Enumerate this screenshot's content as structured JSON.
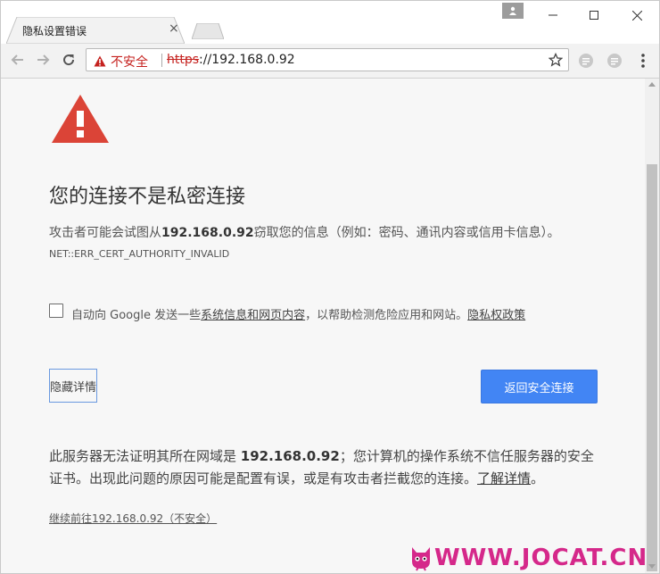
{
  "tab": {
    "title": "隐私设置错误",
    "close": "×"
  },
  "window_controls": {
    "minimize": "—",
    "maximize": "☐",
    "close": "✕"
  },
  "omnibox": {
    "security_label": "不安全",
    "scheme": "https",
    "url_rest": "://192.168.0.92"
  },
  "interstitial": {
    "heading": "您的连接不是私密连接",
    "desc_before": "攻击者可能会试图从",
    "desc_host": "192.168.0.92",
    "desc_after": "窃取您的信息（例如：密码、通讯内容或信用卡信息）。",
    "error_code": "NET::ERR_CERT_AUTHORITY_INVALID",
    "optin_before": "自动向 Google 发送一些",
    "optin_link": "系统信息和网页内容",
    "optin_middle": "，以帮助检测危险应用和网站。",
    "optin_privacy_link": "隐私权政策",
    "hide_details_button": "隐藏详情",
    "back_to_safety_button": "返回安全连接",
    "details_before": "此服务器无法证明其所在网域是 ",
    "details_host": "192.168.0.92",
    "details_after": "；您计算机的操作系统不信任服务器的安全证书。出现此问题的原因可能是配置有误，或是有攻击者拦截您的连接。",
    "learn_more_link": "了解详情",
    "details_end": "。",
    "proceed_link": "继续前往192.168.0.92（不安全）"
  },
  "watermark": {
    "text": "WWW.JOCAT.CN"
  },
  "colors": {
    "warning_red": "#db4437",
    "primary_blue": "#4285f4",
    "watermark_pink": "#d5288a"
  }
}
